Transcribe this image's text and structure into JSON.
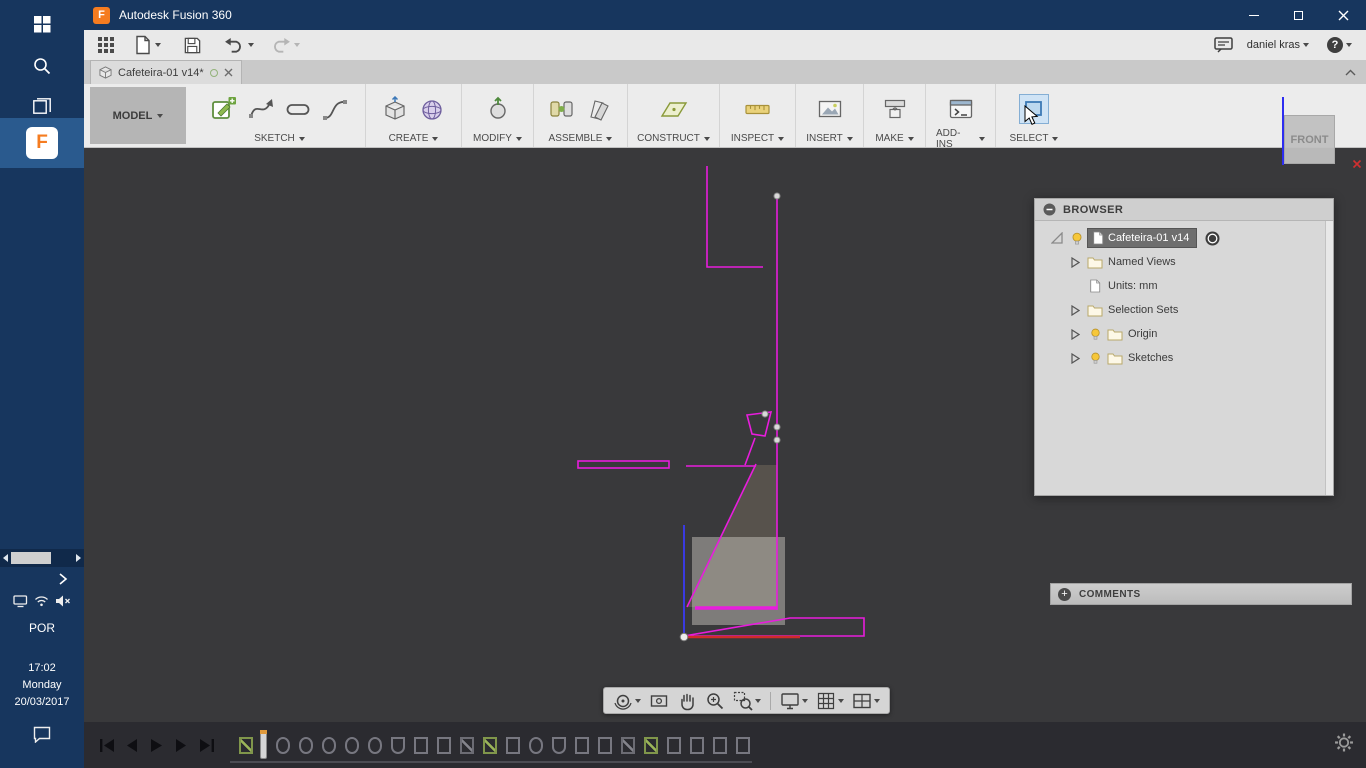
{
  "icons": {
    "help_glyph": "?",
    "plus_glyph": "+",
    "fusion_letter": "F"
  },
  "taskbar": {
    "language": "POR",
    "clock": {
      "time": "17:02",
      "day": "Monday",
      "date": "20/03/2017"
    }
  },
  "titlebar": {
    "title": "Autodesk Fusion 360"
  },
  "qat": {
    "user_name": "daniel kras"
  },
  "document_tab": {
    "title": "Cafeteira-01 v14*"
  },
  "ribbon": {
    "workspace_label": "MODEL",
    "groups": [
      {
        "label": "SKETCH"
      },
      {
        "label": "CREATE"
      },
      {
        "label": "MODIFY"
      },
      {
        "label": "ASSEMBLE"
      },
      {
        "label": "CONSTRUCT"
      },
      {
        "label": "INSPECT"
      },
      {
        "label": "INSERT"
      },
      {
        "label": "MAKE"
      },
      {
        "label": "ADD-INS"
      },
      {
        "label": "SELECT"
      }
    ]
  },
  "viewcube": {
    "front_face": "FRONT"
  },
  "browser": {
    "header": "BROWSER",
    "root_label": "Cafeteira-01 v14",
    "items": [
      {
        "label": "Named Views"
      },
      {
        "label": "Units: mm"
      },
      {
        "label": "Selection Sets"
      },
      {
        "label": "Origin"
      },
      {
        "label": "Sketches"
      }
    ]
  },
  "comments": {
    "header": "COMMENTS"
  },
  "timeline": {
    "items": [
      "sketch",
      "revolve",
      "revolve",
      "revolve",
      "revolve",
      "revolve",
      "cup",
      "extrude",
      "extrude",
      "pencil",
      "sketch",
      "extrude",
      "revolve",
      "cup",
      "extrude",
      "extrude",
      "pencil",
      "sketch",
      "extrude",
      "extrude",
      "extrude",
      "extrude"
    ]
  }
}
